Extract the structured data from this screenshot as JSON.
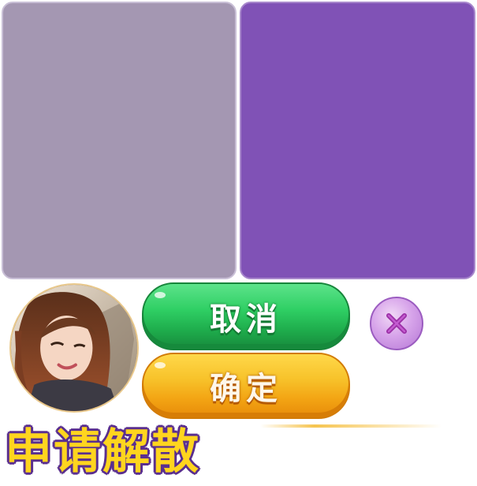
{
  "panels": {
    "left_color": "#a497b2",
    "right_color": "#8052b6"
  },
  "avatar": {
    "icon": "player-avatar-photo"
  },
  "buttons": {
    "cancel_label": "取消",
    "cancel_color": "#2fcf64",
    "confirm_label": "确定",
    "confirm_color": "#f7c22a",
    "close_icon": "close-x-icon"
  },
  "title": {
    "text": "申请解散",
    "color": "#ffd51e"
  }
}
